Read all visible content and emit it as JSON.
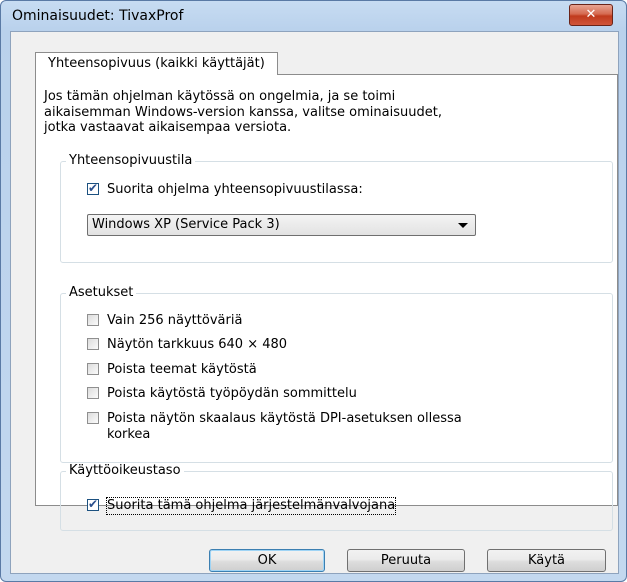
{
  "window": {
    "title": "Ominaisuudet: TivaxProf",
    "close_label": "✕"
  },
  "tab": {
    "label": "Yhteensopivuus (kaikki käyttäjät)"
  },
  "intro_text": "Jos tämän ohjelman käytössä on ongelmia, ja se toimi\naikaisemman Windows-version kanssa, valitse ominaisuudet,\njotka vastaavat aikaisempaa versiota.",
  "compat_group": {
    "label": "Yhteensopivuustila",
    "checkbox_label": "Suorita ohjelma yhteensopivuustilassa:",
    "checked": true,
    "selected_os": "Windows XP (Service Pack 3)"
  },
  "settings_group": {
    "label": "Asetukset",
    "items": [
      {
        "label": "Vain 256 näyttöväriä",
        "checked": false
      },
      {
        "label": "Näytön tarkkuus 640 × 480",
        "checked": false
      },
      {
        "label": "Poista teemat käytöstä",
        "checked": false
      },
      {
        "label": "Poista käytöstä työpöydän sommittelu",
        "checked": false
      },
      {
        "label": "Poista näytön skaalaus käytöstä DPI-asetuksen ollessa\nkorkea",
        "checked": false
      }
    ]
  },
  "privilege_group": {
    "label": "Käyttöoikeustaso",
    "checkbox_label": "Suorita tämä ohjelma järjestelmänvalvojana",
    "checked": true
  },
  "buttons": {
    "ok": "OK",
    "cancel": "Peruuta",
    "apply": "Käytä"
  },
  "colors": {
    "title_bar": "#c7dcf2",
    "close_button": "#c03b1d",
    "default_button_border": "#3c7fb1",
    "checkmark": "#2a4f8c"
  }
}
